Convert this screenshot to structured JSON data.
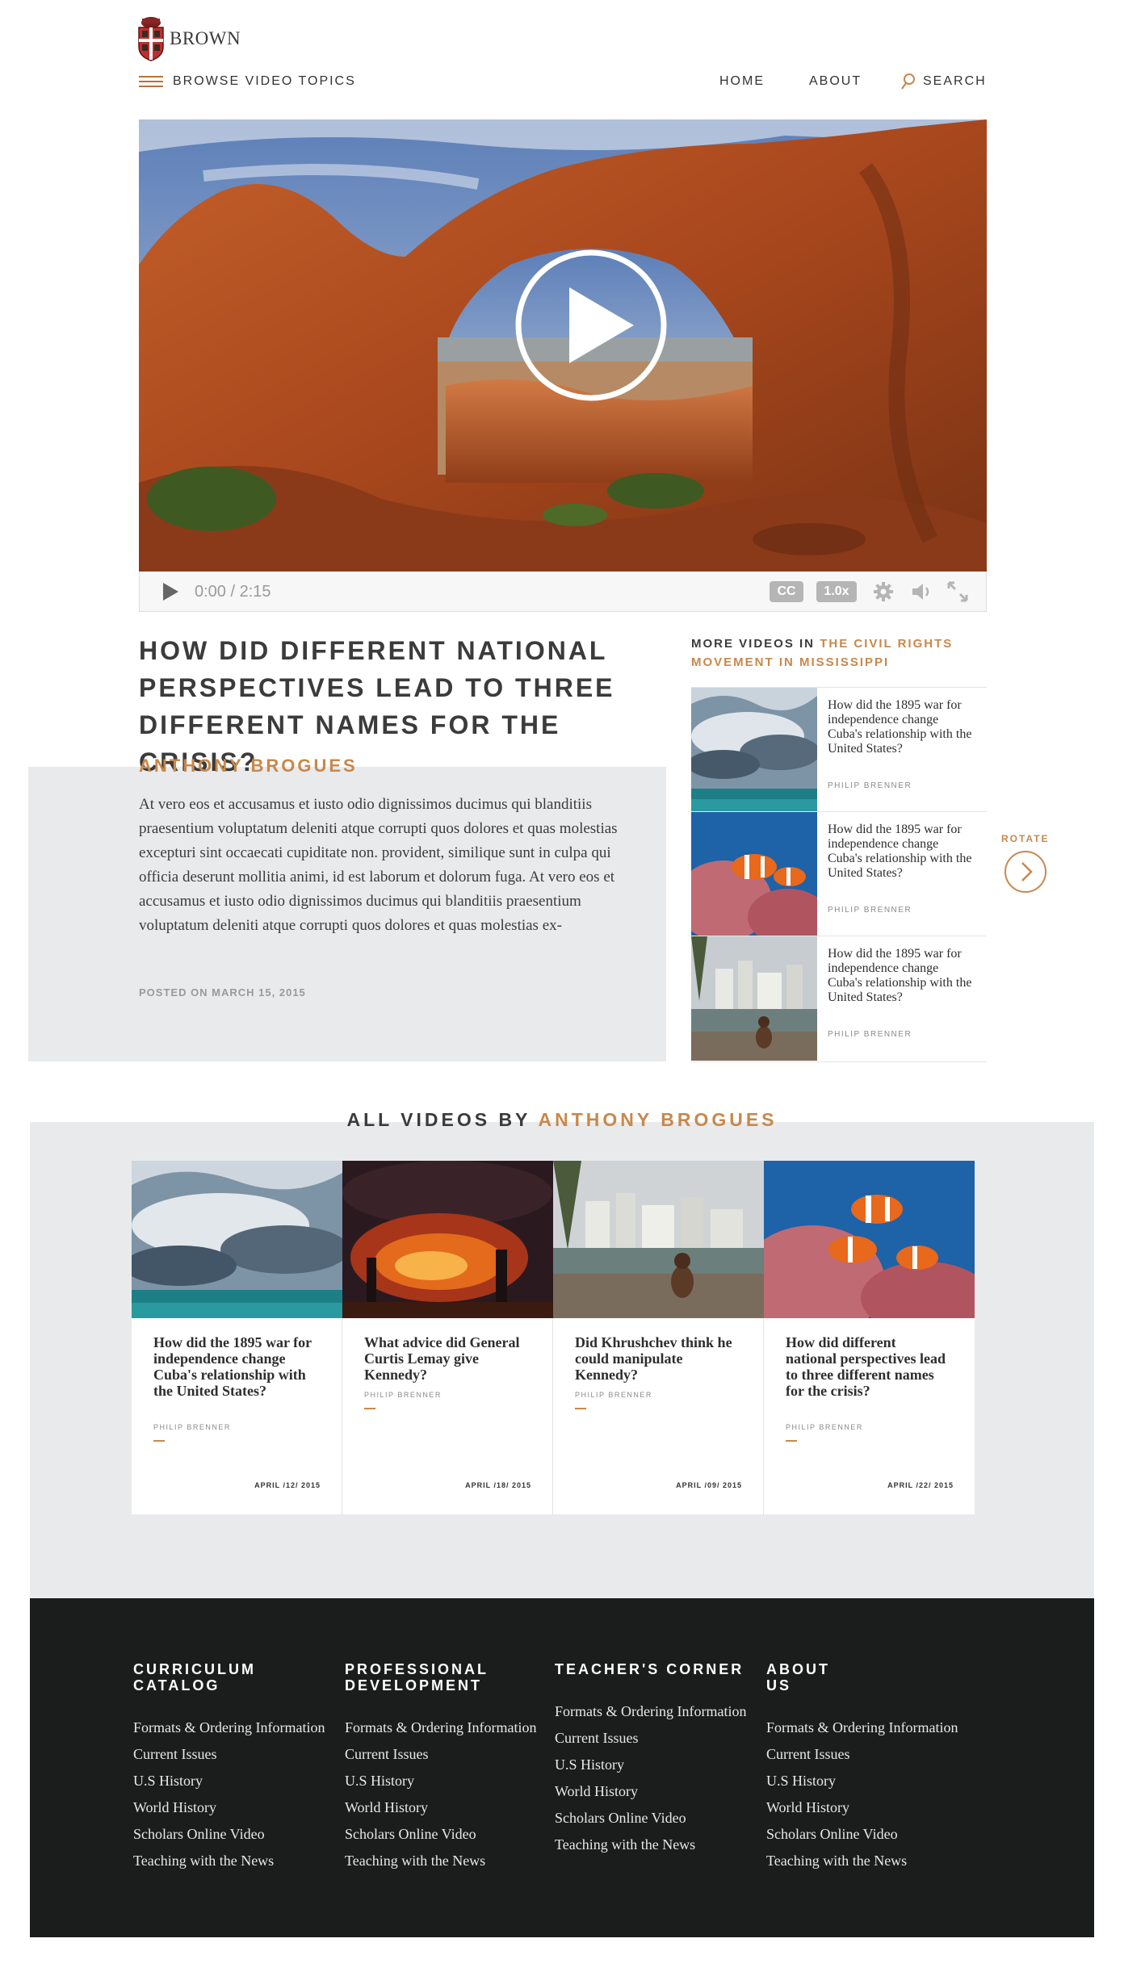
{
  "header": {
    "brand": "BROWN",
    "browse_label": "BROWSE VIDEO TOPICS",
    "nav": {
      "home": "HOME",
      "about": "ABOUT",
      "search": "SEARCH"
    }
  },
  "player": {
    "time": "0:00 / 2:15",
    "cc": "CC",
    "speed": "1.0x"
  },
  "article": {
    "title": "HOW DID DIFFERENT NATIONAL PERSPECTIVES LEAD TO THREE DIFFERENT NAMES FOR THE CRISIS?",
    "author": "ANTHONY BROGUES",
    "body": "At vero eos et accusamus et iusto odio dignissimos ducimus qui blanditiis praesentium voluptatum deleniti atque corrupti quos dolores et quas molestias excepturi sint occaecati cupiditate non. provident, similique sunt in culpa qui officia deserunt mollitia animi, id est laborum et dolorum fuga. At vero eos et accusamus et iusto odio dignissimos ducimus qui blanditiis praesentium voluptatum deleniti atque corrupti quos dolores et quas molestias ex-",
    "posted": "POSTED ON MARCH 15, 2015"
  },
  "sidebar": {
    "heading_prefix": "MORE VIDEOS IN",
    "heading_topic": "THE CIVIL RIGHTS MOVEMENT IN MISSISSIPPI",
    "rotate_label": "ROTATE",
    "items": [
      {
        "title": "How did the 1895 war for independence change Cuba's relationship with the United States?",
        "author": "PHILIP BRENNER"
      },
      {
        "title": "How did the 1895 war for independence change Cuba's relationship with the United States?",
        "author": "PHILIP BRENNER"
      },
      {
        "title": "How did the 1895 war for independence change Cuba's relationship with the United States?",
        "author": "PHILIP BRENNER"
      }
    ]
  },
  "all_videos": {
    "heading_prefix": "ALL VIDEOS BY",
    "heading_author": "ANTHONY BROGUES",
    "cards": [
      {
        "title": "How did the 1895 war for independence change Cuba's relationship with the United States?",
        "author": "PHILIP BRENNER",
        "date": "APRIL /12/ 2015"
      },
      {
        "title": "What advice did General Curtis Lemay give Kennedy?",
        "author": "PHILIP BRENNER",
        "date": "APRIL /18/ 2015"
      },
      {
        "title": "Did Khrushchev think he could manipulate Kennedy?",
        "author": "PHILIP BRENNER",
        "date": "APRIL /09/ 2015"
      },
      {
        "title": "How did different national perspectives lead to three different names for the crisis?",
        "author": "PHILIP BRENNER",
        "date": "APRIL /22/ 2015"
      }
    ]
  },
  "footer": {
    "columns": [
      {
        "heading": "CURRICULUM CATALOG",
        "links": [
          "Formats & Ordering Information",
          "Current Issues",
          "U.S History",
          "World History",
          "Scholars Online Video",
          "Teaching with the News"
        ]
      },
      {
        "heading": "PROFESSIONAL DEVELOPMENT",
        "links": [
          "Formats & Ordering Information",
          "Current Issues",
          "U.S History",
          "World History",
          "Scholars Online Video",
          "Teaching with the News"
        ]
      },
      {
        "heading": "TEACHER'S CORNER",
        "links": [
          "Formats & Ordering Information",
          "Current Issues",
          "U.S History",
          "World History",
          "Scholars Online Video",
          "Teaching with the News"
        ]
      },
      {
        "heading": "ABOUT US",
        "links": [
          "Formats & Ordering Information",
          "Current Issues",
          "U.S History",
          "World History",
          "Scholars Online Video",
          "Teaching with the News"
        ]
      }
    ]
  },
  "colors": {
    "accent": "#c8884c",
    "panel": "#e9eaec",
    "footer": "#1b1c1c"
  },
  "icons": [
    "brown-shield-icon",
    "menu-icon",
    "search-icon",
    "play-icon",
    "cc-icon",
    "settings-icon",
    "volume-icon",
    "fullscreen-icon",
    "chevron-right-icon"
  ]
}
